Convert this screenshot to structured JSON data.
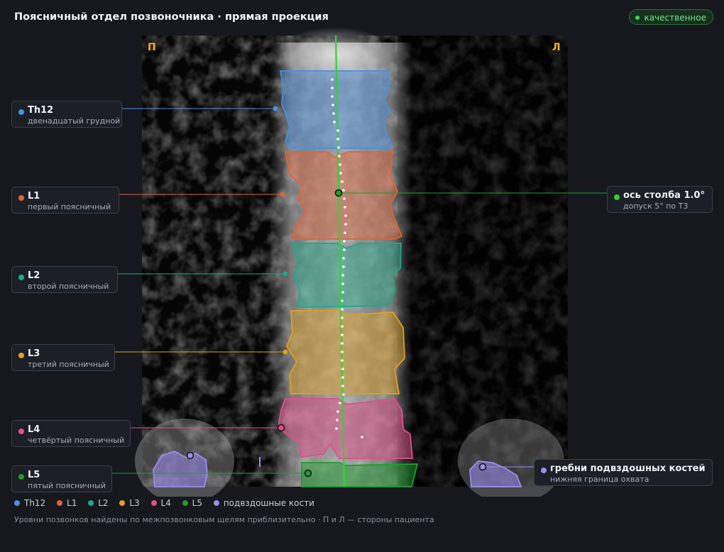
{
  "header": {
    "title": "Поясничный отдел позвоночника · прямая проекция",
    "badge": "качественное"
  },
  "image": {
    "side_right": "П",
    "side_left": "Л"
  },
  "colors": {
    "th12": "#4a90e2",
    "l1": "#e0643a",
    "l2": "#1fa889",
    "l3": "#e0a020",
    "l4": "#e0508a",
    "l5": "#1e9e2e",
    "iliac": "#9b8cf0",
    "axis": "#2fd42f",
    "badge": "#4fd162"
  },
  "labels": {
    "th12": {
      "title": "Th12",
      "subtitle": "двенадцатый грудной"
    },
    "l1": {
      "title": "L1",
      "subtitle": "первый поясничный"
    },
    "l2": {
      "title": "L2",
      "subtitle": "второй поясничный"
    },
    "l3": {
      "title": "L3",
      "subtitle": "третий поясничный"
    },
    "l4": {
      "title": "L4",
      "subtitle": "четвёртый поясничный"
    },
    "l5": {
      "title": "L5",
      "subtitle": "пятый поясничный"
    },
    "axis": {
      "title": "ось столба 1.0°",
      "subtitle": "допуск 5° по Т3"
    },
    "iliac": {
      "title": "гребни подвздошных костей",
      "subtitle": "нижняя граница охвата"
    }
  },
  "legend": [
    {
      "key": "th12",
      "label": "Th12",
      "color": "#4a90e2"
    },
    {
      "key": "l1",
      "label": "L1",
      "color": "#e0643a"
    },
    {
      "key": "l2",
      "label": "L2",
      "color": "#1fa889"
    },
    {
      "key": "l3",
      "label": "L3",
      "color": "#e0a020"
    },
    {
      "key": "l4",
      "label": "L4",
      "color": "#e0508a"
    },
    {
      "key": "l5",
      "label": "L5",
      "color": "#1e9e2e"
    },
    {
      "key": "iliac",
      "label": "подвздошные кости",
      "color": "#9b8cf0"
    }
  ],
  "footnote": "Уровни позвонков найдены по межпозвонковым щелям приблизительно · П и Л — стороны пациента"
}
